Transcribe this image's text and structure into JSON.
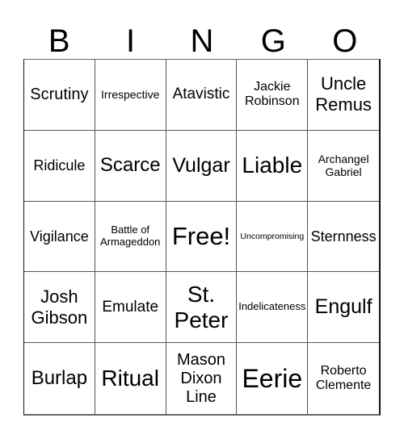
{
  "header": {
    "letters": [
      "B",
      "I",
      "N",
      "G",
      "O"
    ]
  },
  "cells": [
    "Scrutiny",
    "Irrespective",
    "Atavistic",
    "Jackie Robinson",
    "Uncle Remus",
    "Ridicule",
    "Scarce",
    "Vulgar",
    "Liable",
    "Archangel Gabriel",
    "Vigilance",
    "Battle of Armageddon",
    "Free!",
    "Uncompromising",
    "Sternness",
    "Josh Gibson",
    "Emulate",
    "St. Peter",
    "Indelicateness",
    "Engulf",
    "Burlap",
    "Ritual",
    "Mason Dixon Line",
    "Eerie",
    "Roberto Clemente"
  ]
}
